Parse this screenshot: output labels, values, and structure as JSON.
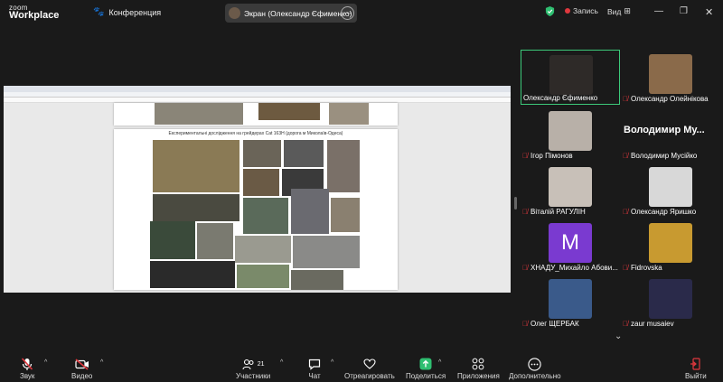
{
  "app": {
    "logo_top": "zoom",
    "logo_bottom": "Workplace",
    "meeting_label": "Конференция"
  },
  "share": {
    "label": "Экран (Олександр Єфименко)",
    "more": "···"
  },
  "topright": {
    "record": "Запись",
    "view": "Вид"
  },
  "document": {
    "caption": "Експериментальні дослідження на  грейдерах Cat 163H (дорога м Миколаїв-Одеса)"
  },
  "participants": [
    {
      "name": "Олександр Єфименко",
      "muted": false,
      "active": true
    },
    {
      "name": "Олександр Олейнікова",
      "muted": true
    },
    {
      "name": "Ігор Пімонов",
      "muted": true
    },
    {
      "name": "Володимир Мусійко",
      "muted": true,
      "display_text": "Володимир  Му..."
    },
    {
      "name": "Віталій РАГУЛІН",
      "muted": true
    },
    {
      "name": "Олександр Яришко",
      "muted": true
    },
    {
      "name": "ХНАДУ_Михайло Абови...",
      "muted": true,
      "avatar_letter": "M"
    },
    {
      "name": "Fidrovska",
      "muted": true
    },
    {
      "name": "Олег ЩЕРБАК",
      "muted": true
    },
    {
      "name": "zaur musaiev",
      "muted": true
    }
  ],
  "toolbar": {
    "audio": "Звук",
    "video": "Видео",
    "participants": "Участники",
    "participants_count": "21",
    "chat": "Чат",
    "react": "Отреагировать",
    "share": "Поделиться",
    "apps": "Приложения",
    "more": "Дополнительно",
    "leave": "Выйти"
  },
  "colors": {
    "accent_green": "#3cc97a",
    "muted_red": "#e0383e",
    "share_green": "#2fbf71",
    "bg": "#1a1a1a"
  }
}
